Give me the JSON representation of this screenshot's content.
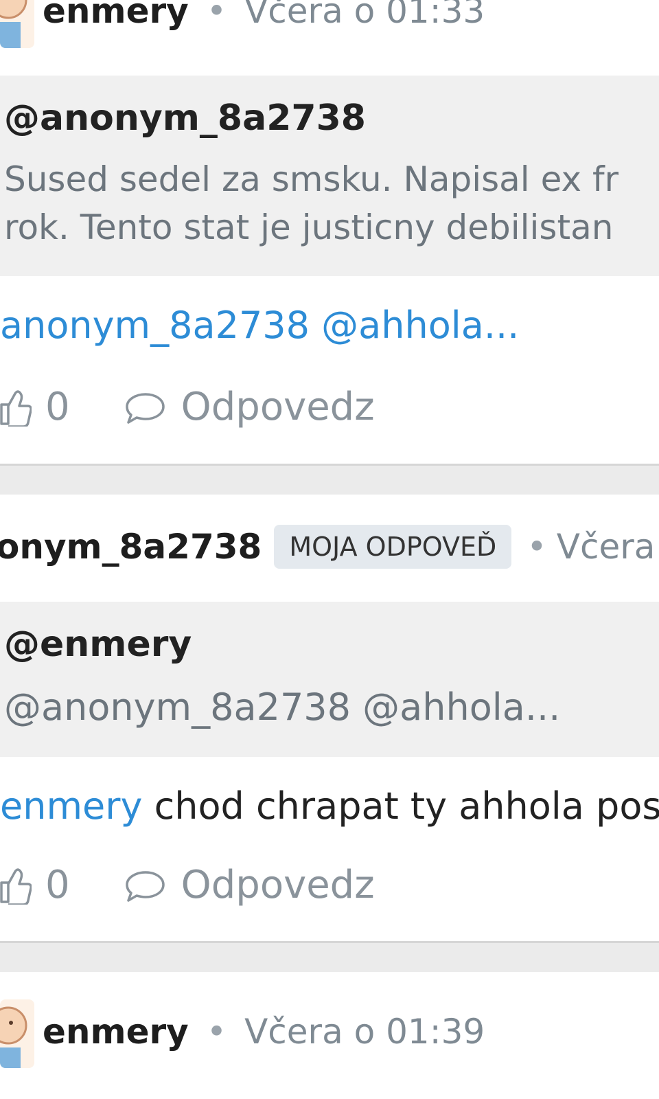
{
  "comment1": {
    "author": "enmery",
    "dot": "•",
    "time": "Včera o 01:33",
    "quote_author": "@anonym_8a2738",
    "quote_text_line1": "Sused sedel za smsku. Napisal ex fr",
    "quote_text_line2": "rok. Tento stat je justicny debilistan",
    "body_link": "anonym_8a2738 @ahhola...",
    "likes": "0",
    "reply_label": "Odpovedz"
  },
  "comment2": {
    "author": "onym_8a2738",
    "badge": "MOJA ODPOVEĎ",
    "dot": "•",
    "time": "Včera o",
    "quote_author": "@enmery",
    "quote_text": "@anonym_8a2738 @ahhola...",
    "body_link": "enmery",
    "body_text": " chod chrapat ty ahhola pos",
    "likes": "0",
    "reply_label": "Odpovedz"
  },
  "comment3": {
    "author": "enmery",
    "dot": "•",
    "time": "Včera o 01:39"
  },
  "icons": {
    "like": "thumbs-up-icon",
    "reply": "speech-bubble-icon",
    "avatar": "user-avatar"
  },
  "colors": {
    "link": "#2d8cd6",
    "quote_bg": "#f0f0f0",
    "separator_bg": "#ebebeb",
    "badge_bg": "#e4e9ee",
    "muted": "#8a939b"
  }
}
